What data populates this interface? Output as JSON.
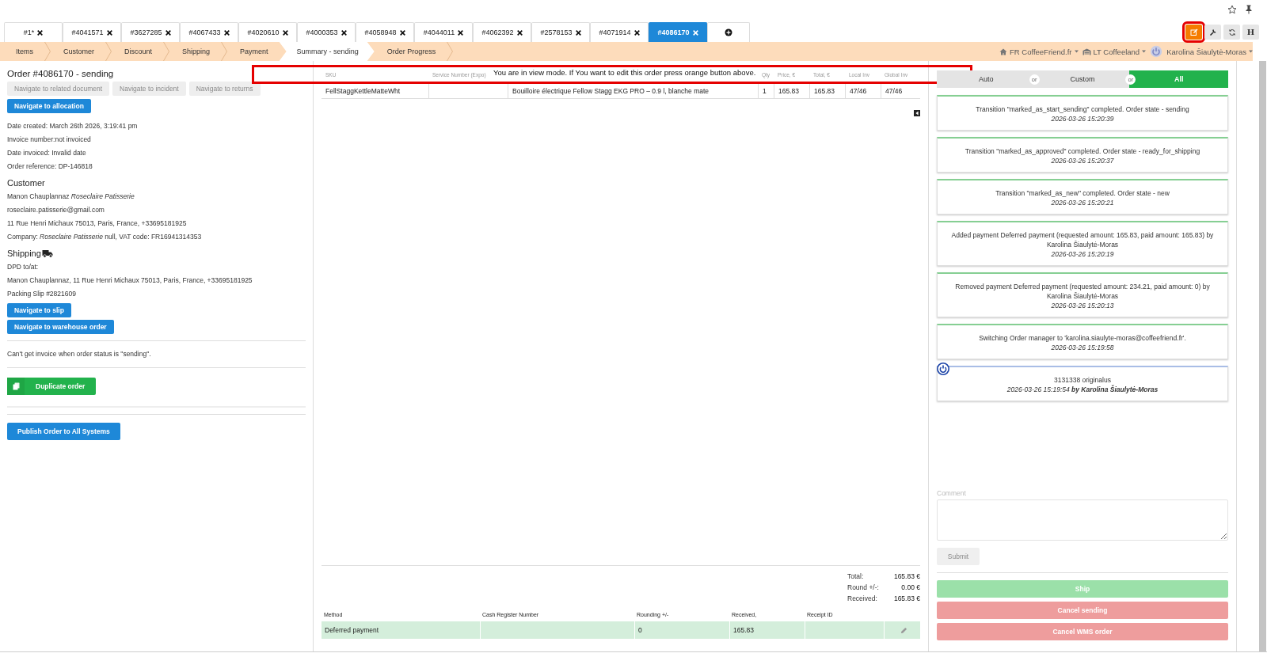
{
  "tabs": [
    {
      "label": "#1*",
      "selected": false
    },
    {
      "label": "#4041571",
      "selected": false
    },
    {
      "label": "#3627285",
      "selected": false
    },
    {
      "label": "#4067433",
      "selected": false
    },
    {
      "label": "#4020610",
      "selected": false
    },
    {
      "label": "#4000353",
      "selected": false
    },
    {
      "label": "#4058948",
      "selected": false
    },
    {
      "label": "#4044011",
      "selected": false
    },
    {
      "label": "#4062392",
      "selected": false
    },
    {
      "label": "#2578153",
      "selected": false
    },
    {
      "label": "#4071914",
      "selected": false
    },
    {
      "label": "#4086170",
      "selected": true
    }
  ],
  "toolbar": [
    {
      "kind": "edit",
      "highlighted": true
    },
    {
      "kind": "wrench",
      "highlighted": false
    },
    {
      "kind": "refresh",
      "highlighted": false
    },
    {
      "kind": "text",
      "label": "H",
      "highlighted": false
    }
  ],
  "steps": [
    {
      "label": "Items",
      "selected": false
    },
    {
      "label": "Customer",
      "selected": false
    },
    {
      "label": "Discount",
      "selected": false
    },
    {
      "label": "Shipping",
      "selected": false
    },
    {
      "label": "Payment",
      "selected": false
    },
    {
      "label": "Summary - sending",
      "selected": true
    },
    {
      "label": "Order Progress",
      "selected": false
    }
  ],
  "context": [
    {
      "kind": "home",
      "label": "FR CoffeeFriend.fr"
    },
    {
      "kind": "warehouse",
      "label": "LT Coffeeland"
    }
  ],
  "user": "Karolina Šiaulytė-Moras",
  "notice": "You are in view mode. If You want to edit this order press orange button above.",
  "order": {
    "title": "Order #4086170 - sending",
    "nav_buttons": [
      {
        "label": "Navigate to related document",
        "disabled": true
      },
      {
        "label": "Navigate to incident",
        "disabled": true
      },
      {
        "label": "Navigate to returns",
        "disabled": true
      },
      {
        "label": "Navigate to allocation",
        "disabled": false
      }
    ],
    "details": [
      "Date created: March 26th 2026, 3:19:41 pm",
      "Invoice number:not invoiced",
      "Date invoiced: Invalid date",
      "Order reference: DP-146818"
    ],
    "customer_heading": "Customer",
    "customer_lines": [
      "Manon Chauplannaz *Roseclaire Patisserie*",
      "roseclaire.patisserie@gmail.com",
      "11 Rue Henri Michaux 75013, Paris, France, +33695181925",
      "Company: *Roseclaire Patisserie* null, VAT code: FR16941314353"
    ],
    "shipping_heading": "Shipping",
    "shipping_lines": [
      "DPD to/at:",
      "Manon Chauplannaz, 11 Rue Henri Michaux 75013, Paris, France, +33695181925",
      "Packing Slip #2821609"
    ],
    "shipping_buttons": [
      "Navigate to slip",
      "Navigate to warehouse order"
    ],
    "invoice_note": "Can't get invoice when order status is \"sending\".",
    "duplicate_button": "Duplicate order",
    "publish_button": "Publish Order to All Systems"
  },
  "items": {
    "columns": [
      "SKU",
      "Service Number (Expo)",
      "Qty",
      "Price, €",
      "Total, €",
      "Local Inv",
      "Global Inv"
    ],
    "rows": [
      {
        "sku": "FellStaggKettleMatteWht",
        "description": "Bouilloire électrique Fellow Stagg EKG PRO – 0.9 l, blanche mate",
        "qty": "1",
        "price": "165.83",
        "total": "165.83",
        "local_inv": "47/46",
        "global_inv": "47/46"
      }
    ]
  },
  "totals": [
    {
      "label": "Total:",
      "value": "165.83 €"
    },
    {
      "label": "Round +/-:",
      "value": "0.00 €"
    },
    {
      "label": "Received:",
      "value": "165.83 €"
    }
  ],
  "payments": {
    "columns": [
      "Method",
      "Cash Register Number",
      "Rounding +/-",
      "Received,",
      "Receipt ID"
    ],
    "rows": [
      {
        "method": "Deferred payment",
        "rounding": "0",
        "received": "165.83"
      }
    ]
  },
  "filter": {
    "segments": [
      {
        "label": "Auto",
        "selected": false
      },
      {
        "label": "Custom",
        "selected": false
      },
      {
        "label": "All",
        "selected": true
      }
    ],
    "separators": [
      "or",
      "or"
    ]
  },
  "events": [
    {
      "kind": "event",
      "text": "Transition \"marked_as_start_sending\" completed. Order state - sending",
      "time": "2026-03-26 15:20:39"
    },
    {
      "kind": "event",
      "text": "Transition \"marked_as_approved\" completed. Order state - ready_for_shipping",
      "time": "2026-03-26 15:20:37"
    },
    {
      "kind": "event",
      "text": "Transition \"marked_as_new\" completed. Order state - new",
      "time": "2026-03-26 15:20:21"
    },
    {
      "kind": "event",
      "text": "Added payment Deferred payment (requested amount: 165.83, paid amount: 165.83) by Karolina Šiaulytė-Moras",
      "time": "2026-03-26 15:20:19"
    },
    {
      "kind": "event",
      "text": "Removed payment Deferred payment (requested amount: 234.21, paid amount: 0) by Karolina Šiaulytė-Moras",
      "time": "2026-03-26 15:20:13"
    },
    {
      "kind": "event",
      "text": "Switching Order manager to 'karolina.siaulyte-moras@coffeefriend.fr'.",
      "time": "2026-03-26 15:19:58"
    },
    {
      "kind": "comment",
      "text": "3131338 originalus",
      "time": "2026-03-26 15:19:54 **by Karolina Šiaulytė-Moras**"
    }
  ],
  "comment": {
    "label": "Comment",
    "submit": "Submit",
    "submit_disabled": true
  },
  "actions": [
    {
      "label": "Ship",
      "kind": "success"
    },
    {
      "label": "Cancel sending",
      "kind": "danger"
    },
    {
      "label": "Cancel WMS order",
      "kind": "danger"
    }
  ]
}
